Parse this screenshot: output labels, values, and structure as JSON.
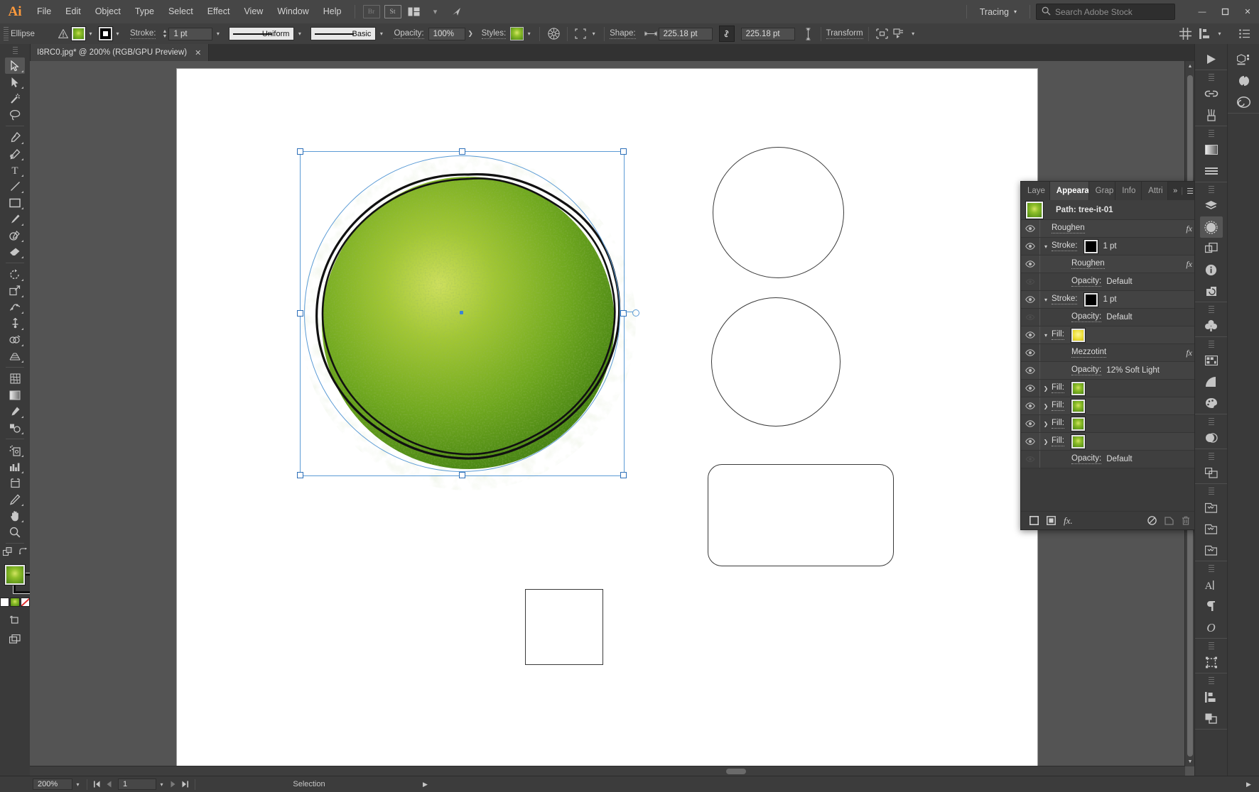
{
  "app": {
    "name": "Adobe Illustrator",
    "logo_text": "Ai"
  },
  "menubar": {
    "items": [
      "File",
      "Edit",
      "Object",
      "Type",
      "Select",
      "Effect",
      "View",
      "Window",
      "Help"
    ],
    "bridge_label": "Br",
    "stock_label": "St",
    "arrange_label": "arrange-documents",
    "workspace": {
      "label": "Tracing"
    },
    "search": {
      "placeholder": "Search Adobe Stock",
      "value": ""
    },
    "window_controls": {
      "minimize": "—",
      "maximize": "☐",
      "close": "✕"
    }
  },
  "controlbar": {
    "selection_type": "Ellipse",
    "warning_icon": "warning-icon",
    "fill_label": "fill-swatch",
    "stroke_color_label": "stroke-swatch",
    "stroke_label": "Stroke:",
    "stroke_weight": "1 pt",
    "stroke_profile": "Uniform",
    "brush_definition": "Basic",
    "opacity_label": "Opacity:",
    "opacity_value": "100%",
    "style_label": "Styles:",
    "shape_label": "Shape:",
    "shape_width": "225.18 pt",
    "shape_height": "225.18 pt",
    "link_ratio": "link-icon",
    "transform_label": "Transform",
    "align_label": "align-icon",
    "arrange_label": "arrange-icon"
  },
  "document": {
    "tab_title": "I8RC0.jpg* @ 200% (RGB/GPU Preview)",
    "close_label": "✕"
  },
  "toolbar": {
    "tools": [
      "selection-tool",
      "direct-selection-tool",
      "magic-wand-tool",
      "lasso-tool",
      "pen-tool",
      "add-anchor-point-tool",
      "type-tool",
      "line-segment-tool",
      "rectangle-tool",
      "paintbrush-tool",
      "shaper-tool",
      "eraser-tool",
      "rotate-tool",
      "scale-tool",
      "width-tool",
      "free-transform-tool",
      "shape-builder-tool",
      "perspective-grid-tool",
      "mesh-tool",
      "gradient-tool",
      "eyedropper-tool",
      "blend-tool",
      "symbol-sprayer-tool",
      "column-graph-tool",
      "artboard-tool",
      "slice-tool",
      "hand-tool",
      "zoom-tool"
    ],
    "fill_swatch": "fill-color-swatch",
    "stroke_swatch": "stroke-color-swatch",
    "swap_icon": "swap-fill-stroke-icon",
    "default_icon": "default-fill-stroke-icon",
    "mini_swatches": [
      "color-mode",
      "gradient-mode",
      "none-mode"
    ],
    "drawing_mode": "draw-normal-icon",
    "screen_mode": "change-screen-mode-icon"
  },
  "appearance_panel": {
    "tabs": [
      {
        "label": "Laye",
        "active": false
      },
      {
        "label": "Appearance",
        "active": true
      },
      {
        "label": "Grap",
        "active": false
      },
      {
        "label": "Info",
        "active": false
      },
      {
        "label": "Attri",
        "active": false
      }
    ],
    "overflow_icon": "»",
    "menu_icon": "☰",
    "header": {
      "thumbnail": "object-thumbnail",
      "title": "Path: tree-it-01"
    },
    "rows": [
      {
        "indent": 0,
        "eye": true,
        "twirl": "",
        "label": "Roughen",
        "underline": true,
        "value": "",
        "swatch": "",
        "fx": true
      },
      {
        "indent": 0,
        "eye": true,
        "twirl": "v",
        "label": "Stroke:",
        "underline": true,
        "value": "1 pt",
        "swatch": "#000000",
        "fx": false
      },
      {
        "indent": 1,
        "eye": true,
        "twirl": "",
        "label": "Roughen",
        "underline": true,
        "value": "",
        "swatch": "",
        "fx": true
      },
      {
        "indent": 1,
        "eye": false,
        "twirl": "",
        "label": "Opacity:",
        "underline": true,
        "value": "Default",
        "swatch": "",
        "fx": false
      },
      {
        "indent": 0,
        "eye": true,
        "twirl": "v",
        "label": "Stroke:",
        "underline": true,
        "value": "1 pt",
        "swatch": "#000000",
        "fx": false
      },
      {
        "indent": 1,
        "eye": false,
        "twirl": "",
        "label": "Opacity:",
        "underline": true,
        "value": "Default",
        "swatch": "",
        "fx": false
      },
      {
        "indent": 0,
        "eye": true,
        "twirl": "v",
        "label": "Fill:",
        "underline": true,
        "value": "",
        "swatch": "#e8e23c",
        "fx": false
      },
      {
        "indent": 1,
        "eye": true,
        "twirl": "",
        "label": "Mezzotint",
        "underline": true,
        "value": "",
        "swatch": "",
        "fx": true
      },
      {
        "indent": 1,
        "eye": true,
        "twirl": "",
        "label": "Opacity:",
        "underline": true,
        "value": "12% Soft Light",
        "swatch": "",
        "fx": false
      },
      {
        "indent": 0,
        "eye": true,
        "twirl": ">",
        "label": "Fill:",
        "underline": true,
        "value": "",
        "swatch": "#4a8a1a",
        "fx": false
      },
      {
        "indent": 0,
        "eye": true,
        "twirl": ">",
        "label": "Fill:",
        "underline": true,
        "value": "",
        "swatch": "#4a8a1a",
        "fx": false
      },
      {
        "indent": 0,
        "eye": true,
        "twirl": ">",
        "label": "Fill:",
        "underline": true,
        "value": "",
        "swatch": "#4a8a1a",
        "fx": false
      },
      {
        "indent": 0,
        "eye": true,
        "twirl": ">",
        "label": "Fill:",
        "underline": true,
        "value": "",
        "swatch": "#4a8a1a",
        "fx": false
      },
      {
        "indent": 1,
        "eye": false,
        "twirl": "",
        "label": "Opacity:",
        "underline": true,
        "value": "Default",
        "swatch": "",
        "fx": false
      }
    ],
    "footer": {
      "add_stroke": "add-new-stroke-icon",
      "add_fill": "add-new-fill-icon",
      "add_effect": "add-effect-icon",
      "clear": "clear-appearance-icon",
      "duplicate": "duplicate-item-icon",
      "delete": "delete-item-icon"
    }
  },
  "right_dock": {
    "column_one": [
      "libraries-play-icon",
      "links-icon",
      "brushes-icon",
      "gradient-icon",
      "stroke-panel-icon",
      "layers-icon",
      "appearance-icon",
      "pathfinder-icon",
      "info-icon",
      "transform-panel-icon",
      "symbols-icon",
      "swatches-icon",
      "color-guide-icon",
      "color-panel-icon",
      "transparency-icon",
      "align-panel-icon",
      "artboards-icon",
      "asset-export-icon",
      "document-info-icon",
      "character-icon",
      "paragraph-icon",
      "glyphs-icon",
      "image-trace-icon",
      "align-objects-icon",
      "pathfinder-shapes-icon"
    ],
    "column_two": [
      "3d-materials-icon",
      "history-icon",
      "creative-cloud-icon"
    ]
  },
  "statusbar": {
    "zoom": "200%",
    "artboard_number": "1",
    "nav_first": "first-artboard",
    "nav_prev": "previous-artboard",
    "nav_next": "next-artboard",
    "nav_last": "last-artboard",
    "status_text": "Selection",
    "expand_icon": "▶"
  },
  "canvas": {
    "artboard_background": "#ffffff",
    "selected_object": {
      "name": "tree-it-01",
      "type": "ellipse",
      "width_pt": "225.18 pt",
      "height_pt": "225.18 pt",
      "fill_gradient": [
        "#c9dd55",
        "#7fb521",
        "#3f7d10"
      ],
      "stroke_color": "#000000"
    },
    "shapes": [
      {
        "name": "circle-top",
        "type": "circle"
      },
      {
        "name": "circle-middle",
        "type": "circle"
      },
      {
        "name": "rounded-rectangle",
        "type": "rounded-rect"
      },
      {
        "name": "square",
        "type": "square"
      }
    ]
  },
  "colors": {
    "chrome": "#3a3a3a",
    "panel": "#3b3b3b",
    "accent_selection": "#5b9bd5",
    "brand_orange": "#ff9a3c",
    "canvas_gray": "#545454"
  }
}
